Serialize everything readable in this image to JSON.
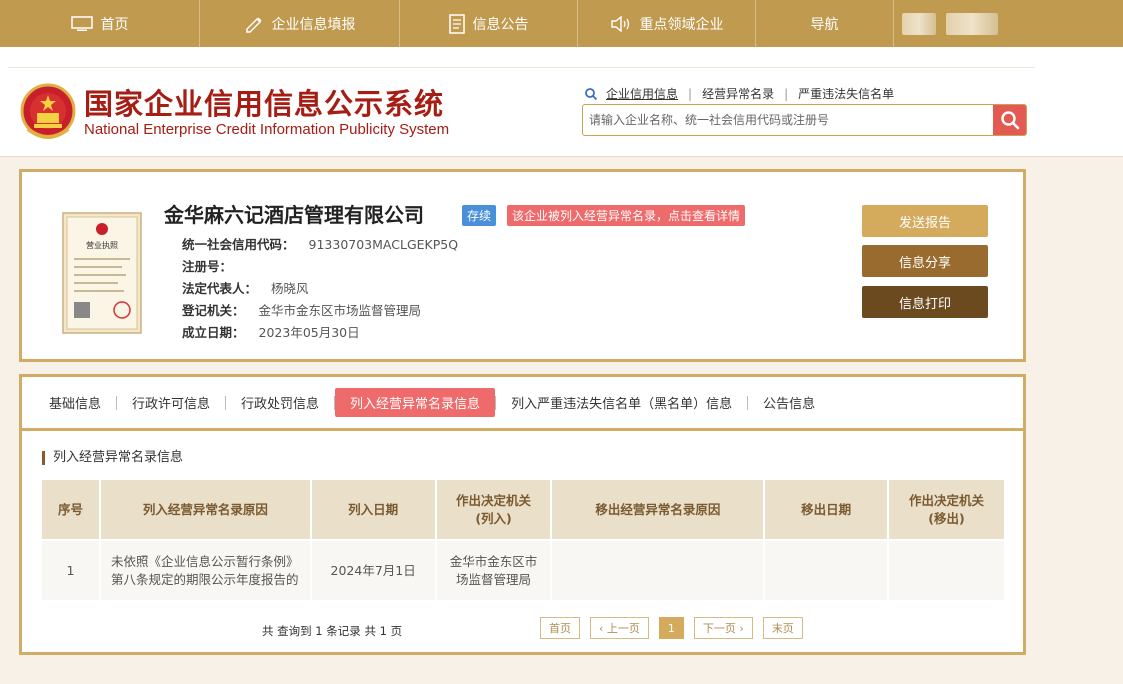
{
  "nav": {
    "items": [
      {
        "label": "首页",
        "icon": "monitor-icon"
      },
      {
        "label": "企业信息填报",
        "icon": "edit-icon"
      },
      {
        "label": "信息公告",
        "icon": "document-icon"
      },
      {
        "label": "重点领域企业",
        "icon": "speaker-icon"
      },
      {
        "label": "导航",
        "icon": ""
      }
    ]
  },
  "header": {
    "title_cn": "国家企业信用信息公示系统",
    "title_en": "National Enterprise Credit Information Publicity System",
    "links": [
      "企业信用信息",
      "经营异常名录",
      "严重违法失信名单"
    ],
    "search_placeholder": "请输入企业名称、统一社会信用代码或注册号"
  },
  "company": {
    "name": "金华麻六记酒店管理有限公司",
    "status": "存续",
    "warning": "该企业被列入经营异常名录，点击查看详情",
    "fields": [
      {
        "key": "统一社会信用代码：",
        "value": "91330703MACLGEKP5Q"
      },
      {
        "key": "注册号：",
        "value": ""
      },
      {
        "key": "法定代表人：",
        "value": "杨晓风"
      },
      {
        "key": "登记机关：",
        "value": "金华市金东区市场监督管理局"
      },
      {
        "key": "成立日期：",
        "value": "2023年05月30日"
      }
    ],
    "license_label": "营业执照",
    "buttons": {
      "report": "发送报告",
      "share": "信息分享",
      "print": "信息打印"
    }
  },
  "tabs": [
    "基础信息",
    "行政许可信息",
    "行政处罚信息",
    "列入经营异常名录信息",
    "列入严重违法失信名单（黑名单）信息",
    "公告信息"
  ],
  "section": {
    "title": "列入经营异常名录信息",
    "headers": [
      "序号",
      "列入经营异常名录原因",
      "列入日期",
      "作出决定机关(列入)",
      "移出经营异常名录原因",
      "移出日期",
      "作出决定机关(移出)"
    ],
    "rows": [
      [
        "1",
        "未依照《企业信息公示暂行条例》第八条规定的期限公示年度报告的",
        "2024年7月1日",
        "金华市金东区市场监督管理局",
        "",
        "",
        ""
      ]
    ],
    "summary": "共 查询到 1 条记录 共 1 页",
    "pager": {
      "first": "首页",
      "prev": "‹ 上一页",
      "current": "1",
      "next": "下一页 ›",
      "last": "末页"
    }
  }
}
